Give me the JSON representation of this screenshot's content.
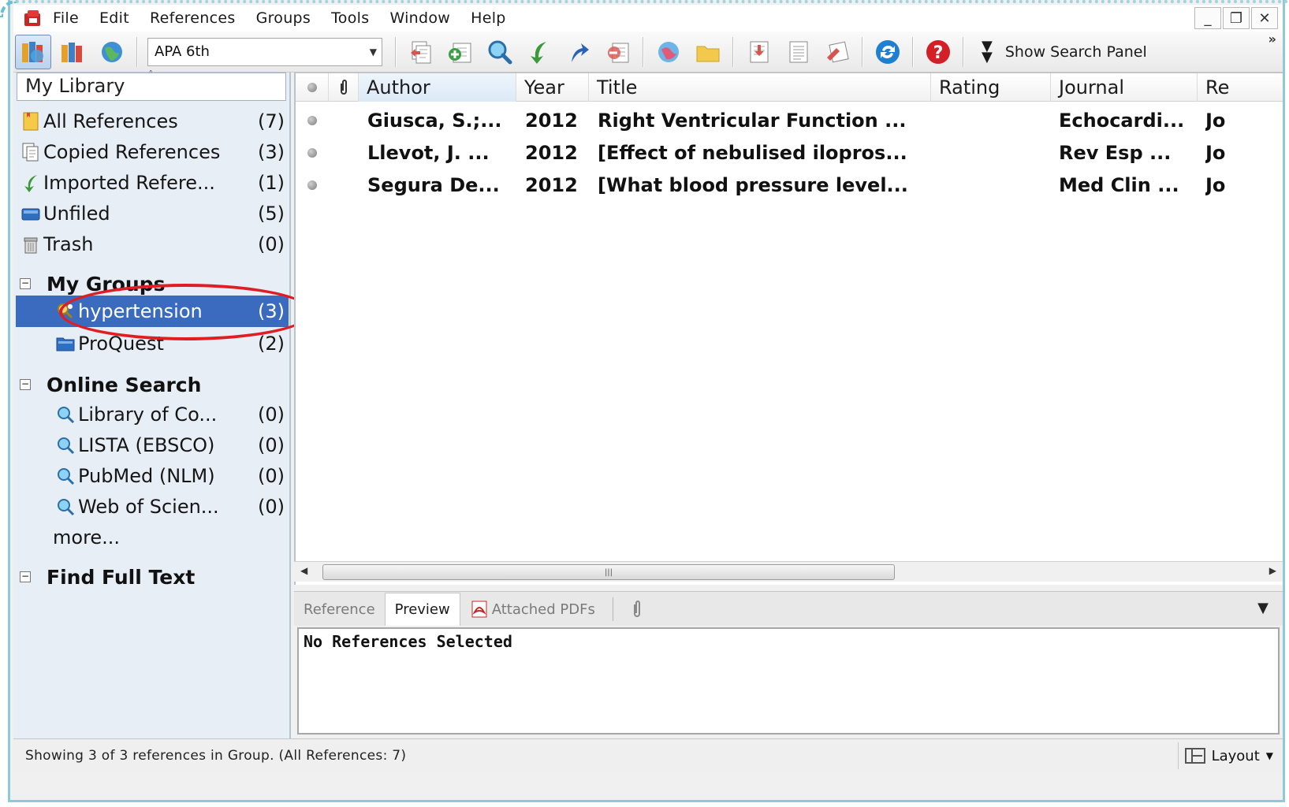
{
  "menu": {
    "items": [
      "File",
      "Edit",
      "References",
      "Groups",
      "Tools",
      "Window",
      "Help"
    ]
  },
  "toolbar": {
    "output_style": "APA 6th",
    "show_search_panel": "Show Search Panel",
    "icons": [
      "local-library-mode-icon",
      "integrated-library-mode-icon",
      "online-search-mode-icon",
      "copy-to-library-icon",
      "new-reference-icon",
      "online-search-icon",
      "import-icon",
      "export-icon",
      "find-full-text-icon",
      "open-link-icon",
      "open-file-icon",
      "insert-citation-icon",
      "format-bibliography-icon",
      "return-to-word-icon",
      "sync-icon",
      "help-icon"
    ]
  },
  "left_panel": {
    "header": "My Library",
    "library_items": [
      {
        "label": "All References",
        "count": "(7)",
        "icon": "all-references-icon"
      },
      {
        "label": "Copied References",
        "count": "(3)",
        "icon": "copied-references-icon"
      },
      {
        "label": "Imported Refere...",
        "count": "(1)",
        "icon": "imported-references-icon"
      },
      {
        "label": "Unfiled",
        "count": "(5)",
        "icon": "unfiled-icon"
      },
      {
        "label": "Trash",
        "count": "(0)",
        "icon": "trash-icon"
      }
    ],
    "my_groups": {
      "title": "My Groups",
      "items": [
        {
          "label": "hypertension",
          "count": "(3)",
          "icon": "smart-group-icon"
        },
        {
          "label": "ProQuest",
          "count": "(2)",
          "icon": "folder-icon"
        }
      ]
    },
    "online_search": {
      "title": "Online Search",
      "items": [
        {
          "label": "Library of Co...",
          "count": "(0)",
          "icon": "online-search-icon"
        },
        {
          "label": "LISTA (EBSCO)",
          "count": "(0)",
          "icon": "online-search-icon"
        },
        {
          "label": "PubMed (NLM)",
          "count": "(0)",
          "icon": "online-search-icon"
        },
        {
          "label": "Web of Scien...",
          "count": "(0)",
          "icon": "online-search-icon"
        }
      ],
      "more": "more..."
    },
    "find_full_text": {
      "title": "Find Full Text"
    }
  },
  "reference_list": {
    "columns": [
      "Author",
      "Year",
      "Title",
      "Rating",
      "Journal",
      "Re"
    ],
    "rows": [
      {
        "author": "Giusca, S.;...",
        "year": "2012",
        "title": "Right Ventricular Function ...",
        "rating": "",
        "journal": "Echocardi...",
        "ref_type": "Jo"
      },
      {
        "author": "Llevot, J. ...",
        "year": "2012",
        "title": "[Effect of nebulised ilopros...",
        "rating": "",
        "journal": "Rev Esp ...",
        "ref_type": "Jo"
      },
      {
        "author": "Segura De...",
        "year": "2012",
        "title": "[What blood pressure level...",
        "rating": "",
        "journal": "Med Clin ...",
        "ref_type": "Jo"
      }
    ]
  },
  "preview_tabs": {
    "tabs": [
      "Reference",
      "Preview",
      "Attached PDFs"
    ],
    "active": "Preview",
    "message": "No References Selected"
  },
  "status": {
    "text": "Showing 3 of 3 references in Group. (All References: 7)",
    "layout": "Layout"
  },
  "colors": {
    "selection": "#3b6bbf",
    "annotation_circle": "#e11d24",
    "frame": "#8ec9d6"
  }
}
